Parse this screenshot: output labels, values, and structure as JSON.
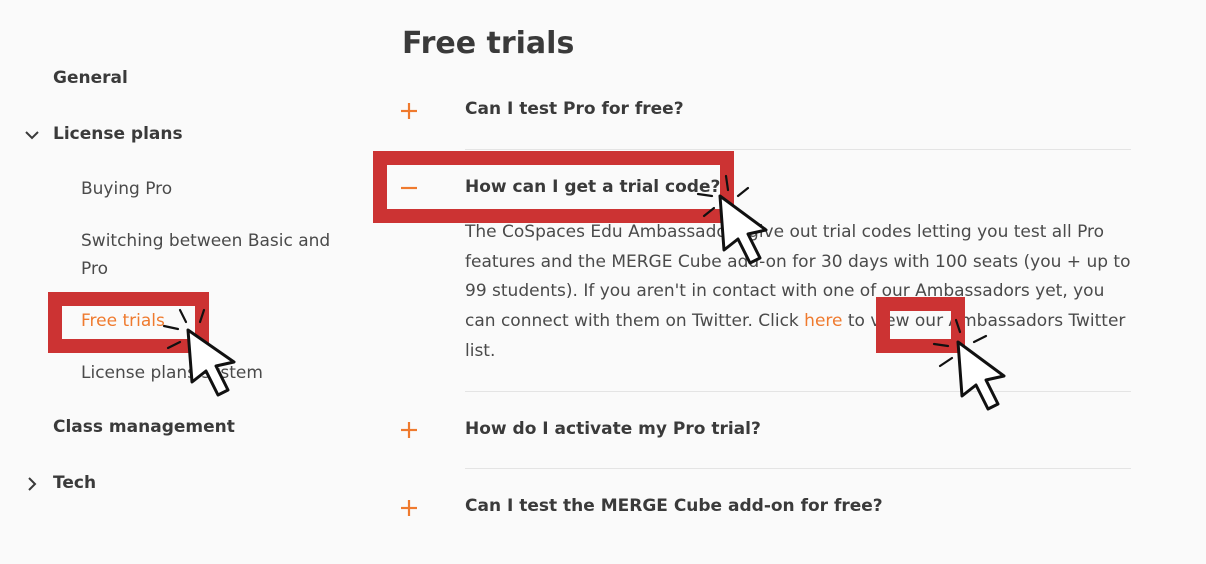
{
  "sidebar": {
    "general": "General",
    "license_plans": "License plans",
    "buying_pro": "Buying Pro",
    "switching": "Switching between Basic and Pro",
    "free_trials": "Free trials",
    "license_system": "License plans system",
    "class_management": "Class management",
    "tech": "Tech"
  },
  "main": {
    "title": "Free trials",
    "faqs": [
      {
        "question": "Can I test Pro for free?"
      },
      {
        "question": "How can I get a trial code?"
      },
      {
        "question": "How do I activate my Pro trial?"
      },
      {
        "question": "Can I test the MERGE Cube add-on for free?"
      }
    ],
    "answer": {
      "before_link": "The CoSpaces Edu Ambassadors give out trial codes letting you test all Pro features and the MERGE Cube add-on for 30 days with 100 seats (you + up to 99 students). If you aren't in contact with one of our Ambassadors yet, you can connect with them on Twitter. Click ",
      "link": "here",
      "after_link": " to view our Ambassadors Twitter list."
    }
  },
  "colors": {
    "accent": "#ef7a2e",
    "annotation": "#cc3333",
    "text": "#3a3a3a",
    "background": "#fafafa"
  },
  "icons": {
    "collapse": "chevron-down-icon",
    "expand": "chevron-right-icon",
    "faq_closed": "plus-icon",
    "faq_open": "minus-icon",
    "pointer": "cursor-pointer-icon"
  }
}
